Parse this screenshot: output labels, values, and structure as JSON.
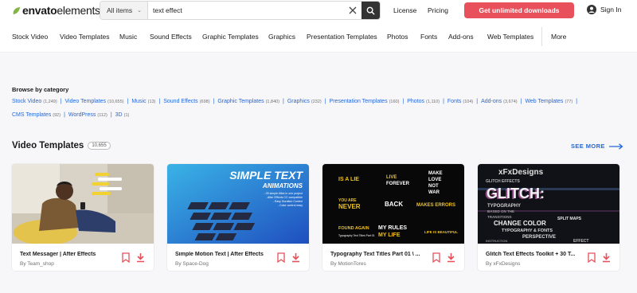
{
  "header": {
    "logo_bold": "envato",
    "logo_light": "elements",
    "filter_label": "All items",
    "search_value": "text effect",
    "links": [
      "License",
      "Pricing"
    ],
    "cta_label": "Get unlimited downloads",
    "signin_label": "Sign In"
  },
  "nav": {
    "items": [
      "Stock Video",
      "Video Templates",
      "Music",
      "Sound Effects",
      "Graphic Templates",
      "Graphics",
      "Presentation Templates",
      "Photos",
      "Fonts",
      "Add-ons",
      "Web Templates"
    ],
    "more_label": "More"
  },
  "browse": {
    "title": "Browse by category",
    "row1": [
      {
        "name": "Stock Video",
        "count": "(1,249)"
      },
      {
        "name": "Video Templates",
        "count": "(10,655)"
      },
      {
        "name": "Music",
        "count": "(13)"
      },
      {
        "name": "Sound Effects",
        "count": "(698)"
      },
      {
        "name": "Graphic Templates",
        "count": "(1,840)"
      },
      {
        "name": "Graphics",
        "count": "(232)"
      },
      {
        "name": "Presentation Templates",
        "count": "(160)"
      },
      {
        "name": "Photos",
        "count": "(1,110)"
      },
      {
        "name": "Fonts",
        "count": "(104)"
      },
      {
        "name": "Add-ons",
        "count": "(3,674)"
      },
      {
        "name": "Web Templates",
        "count": "(77)"
      }
    ],
    "row2": [
      {
        "name": "CMS Templates",
        "count": "(92)"
      },
      {
        "name": "WordPress",
        "count": "(112)"
      },
      {
        "name": "3D",
        "count": "(1)"
      }
    ]
  },
  "section": {
    "title": "Video Templates",
    "count": "10,655",
    "see_more": "SEE MORE"
  },
  "cards": [
    {
      "title": "Text Messager | After Effects",
      "author": "By Team_shop"
    },
    {
      "title": "Simple Motion Text | After Effects",
      "author": "By Space-Dog"
    },
    {
      "title": "Typography Text Titles Part 01 \\ ...",
      "author": "By MotionTores"
    },
    {
      "title": "Glitch Text Effects Toolkit + 30 T...",
      "author": "By xFxDesigns"
    }
  ],
  "thumbs": {
    "simple_text": {
      "title": "SIMPLE TEXT",
      "subtitle": "ANIMATIONS",
      "bullets": [
        "- 25 simple titles in one project",
        "- After Effects CC compatible",
        "- Easy Duration Control",
        "- Color control easy"
      ]
    },
    "typography": {
      "words": [
        "IS A LIE",
        "LIVE",
        "FOREVER",
        "MAKE",
        "LOVE",
        "NOT",
        "WAR",
        "YOU ARE",
        "NEVER",
        "BACK",
        "MAKES ERRORS",
        "FOUND AGAIN",
        "MY RULES",
        "MY LIFE",
        "LIFE IS BEAUTIFUL"
      ],
      "caption": "Typography Text Titles Part 01"
    },
    "glitch": {
      "brand": "xFxDesigns",
      "lines": [
        "GLITCH EFFECTS",
        "GLITCH:",
        "TYPOGRAPHY",
        "BASED ON THE",
        "TRANSITIONS",
        "CHANGE COLOR",
        "TYPOGRAPHY & FONTS",
        "PERSPECTIVE",
        "INSTRUCTION",
        "SPLIT MAPS",
        "EFFECT"
      ]
    }
  },
  "colors": {
    "accent": "#e8505b",
    "link": "#2469d9",
    "bookmark": "#e8505b"
  }
}
